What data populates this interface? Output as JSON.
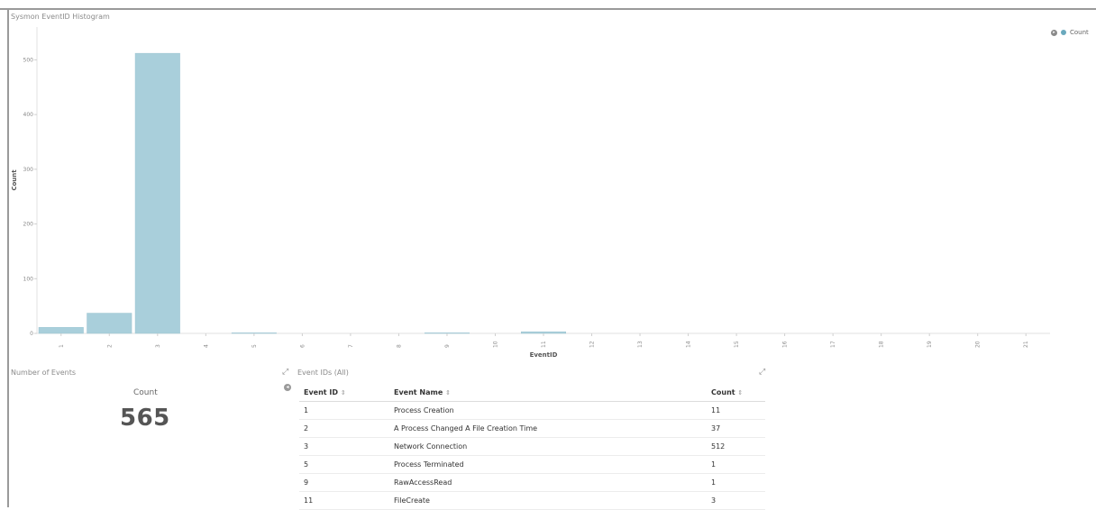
{
  "histogram": {
    "title": "Sysmon EventID Histogram",
    "legend_label": "Count",
    "legend_toggle_icon": "chevron-right-icon",
    "accent_color": "#a9cfdb"
  },
  "chart_data": {
    "type": "bar",
    "title": "Sysmon EventID Histogram",
    "xlabel": "EventID",
    "ylabel": "Count",
    "categories": [
      "1",
      "2",
      "3",
      "4",
      "5",
      "6",
      "7",
      "8",
      "9",
      "10",
      "11",
      "12",
      "13",
      "14",
      "15",
      "16",
      "17",
      "18",
      "19",
      "20",
      "21"
    ],
    "series": [
      {
        "name": "Count",
        "values": [
          11,
          37,
          512,
          0,
          1,
          0,
          0,
          0,
          1,
          0,
          3,
          0,
          0,
          0,
          0,
          0,
          0,
          0,
          0,
          0,
          0
        ]
      }
    ],
    "y_ticks": [
      0,
      100,
      200,
      300,
      400,
      500
    ],
    "ylim": [
      0,
      560
    ],
    "grid": false,
    "legend": "top-right"
  },
  "metric": {
    "title": "Number of Events",
    "label": "Count",
    "value": "565"
  },
  "event_table": {
    "title": "Event IDs (All)",
    "columns": [
      "Event ID",
      "Event Name",
      "Count"
    ],
    "rows": [
      [
        "1",
        "Process Creation",
        "11"
      ],
      [
        "2",
        "A Process Changed A File Creation Time",
        "37"
      ],
      [
        "3",
        "Network Connection",
        "512"
      ],
      [
        "5",
        "Process Terminated",
        "1"
      ],
      [
        "9",
        "RawAccessRead",
        "1"
      ],
      [
        "11",
        "FileCreate",
        "3"
      ]
    ]
  }
}
